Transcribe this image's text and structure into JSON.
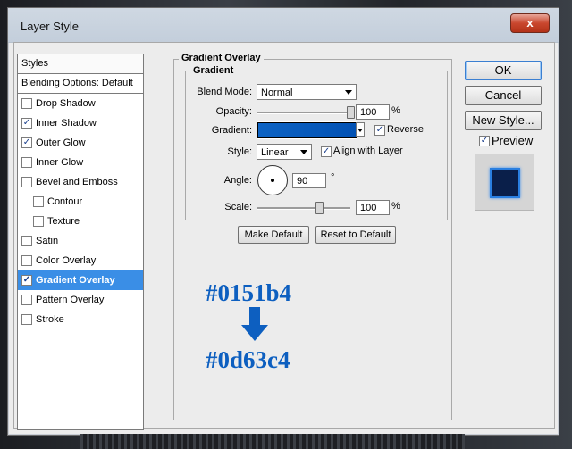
{
  "window": {
    "title": "Layer Style",
    "close_glyph": "x"
  },
  "sidebar": {
    "header": "Styles",
    "blending": "Blending Options: Default",
    "items": [
      {
        "label": "Drop Shadow",
        "checked": false
      },
      {
        "label": "Inner Shadow",
        "checked": true
      },
      {
        "label": "Outer Glow",
        "checked": true
      },
      {
        "label": "Inner Glow",
        "checked": false
      },
      {
        "label": "Bevel and Emboss",
        "checked": false
      },
      {
        "label": "Contour",
        "checked": false
      },
      {
        "label": "Texture",
        "checked": false
      },
      {
        "label": "Satin",
        "checked": false
      },
      {
        "label": "Color Overlay",
        "checked": false
      },
      {
        "label": "Gradient Overlay",
        "checked": true
      },
      {
        "label": "Pattern Overlay",
        "checked": false
      },
      {
        "label": "Stroke",
        "checked": false
      }
    ],
    "check_glyph": "✓"
  },
  "panel": {
    "title": "Gradient Overlay",
    "group_title": "Gradient",
    "blend_mode_label": "Blend Mode:",
    "blend_mode_value": "Normal",
    "opacity_label": "Opacity:",
    "opacity_value": "100",
    "opacity_unit": "%",
    "opacity_level": 100,
    "gradient_label": "Gradient:",
    "reverse_label": "Reverse",
    "reverse_checked": true,
    "style_label": "Style:",
    "style_value": "Linear",
    "align_label": "Align with Layer",
    "align_checked": true,
    "angle_label": "Angle:",
    "angle_value": "90",
    "angle_unit": "°",
    "scale_label": "Scale:",
    "scale_value": "100",
    "scale_unit": "%",
    "scale_level": 66,
    "make_default": "Make Default",
    "reset_default": "Reset to Default"
  },
  "annotation": {
    "color_start": "#0151b4",
    "color_end": "#0d63c4",
    "arrow_color": "#0d5fc0"
  },
  "right": {
    "ok": "OK",
    "cancel": "Cancel",
    "new_style": "New Style...",
    "preview_label": "Preview",
    "preview_checked": true
  },
  "colors": {
    "selection": "#3a8ee6",
    "gradient_from": "#0d63c4",
    "gradient_to": "#0151b4"
  }
}
